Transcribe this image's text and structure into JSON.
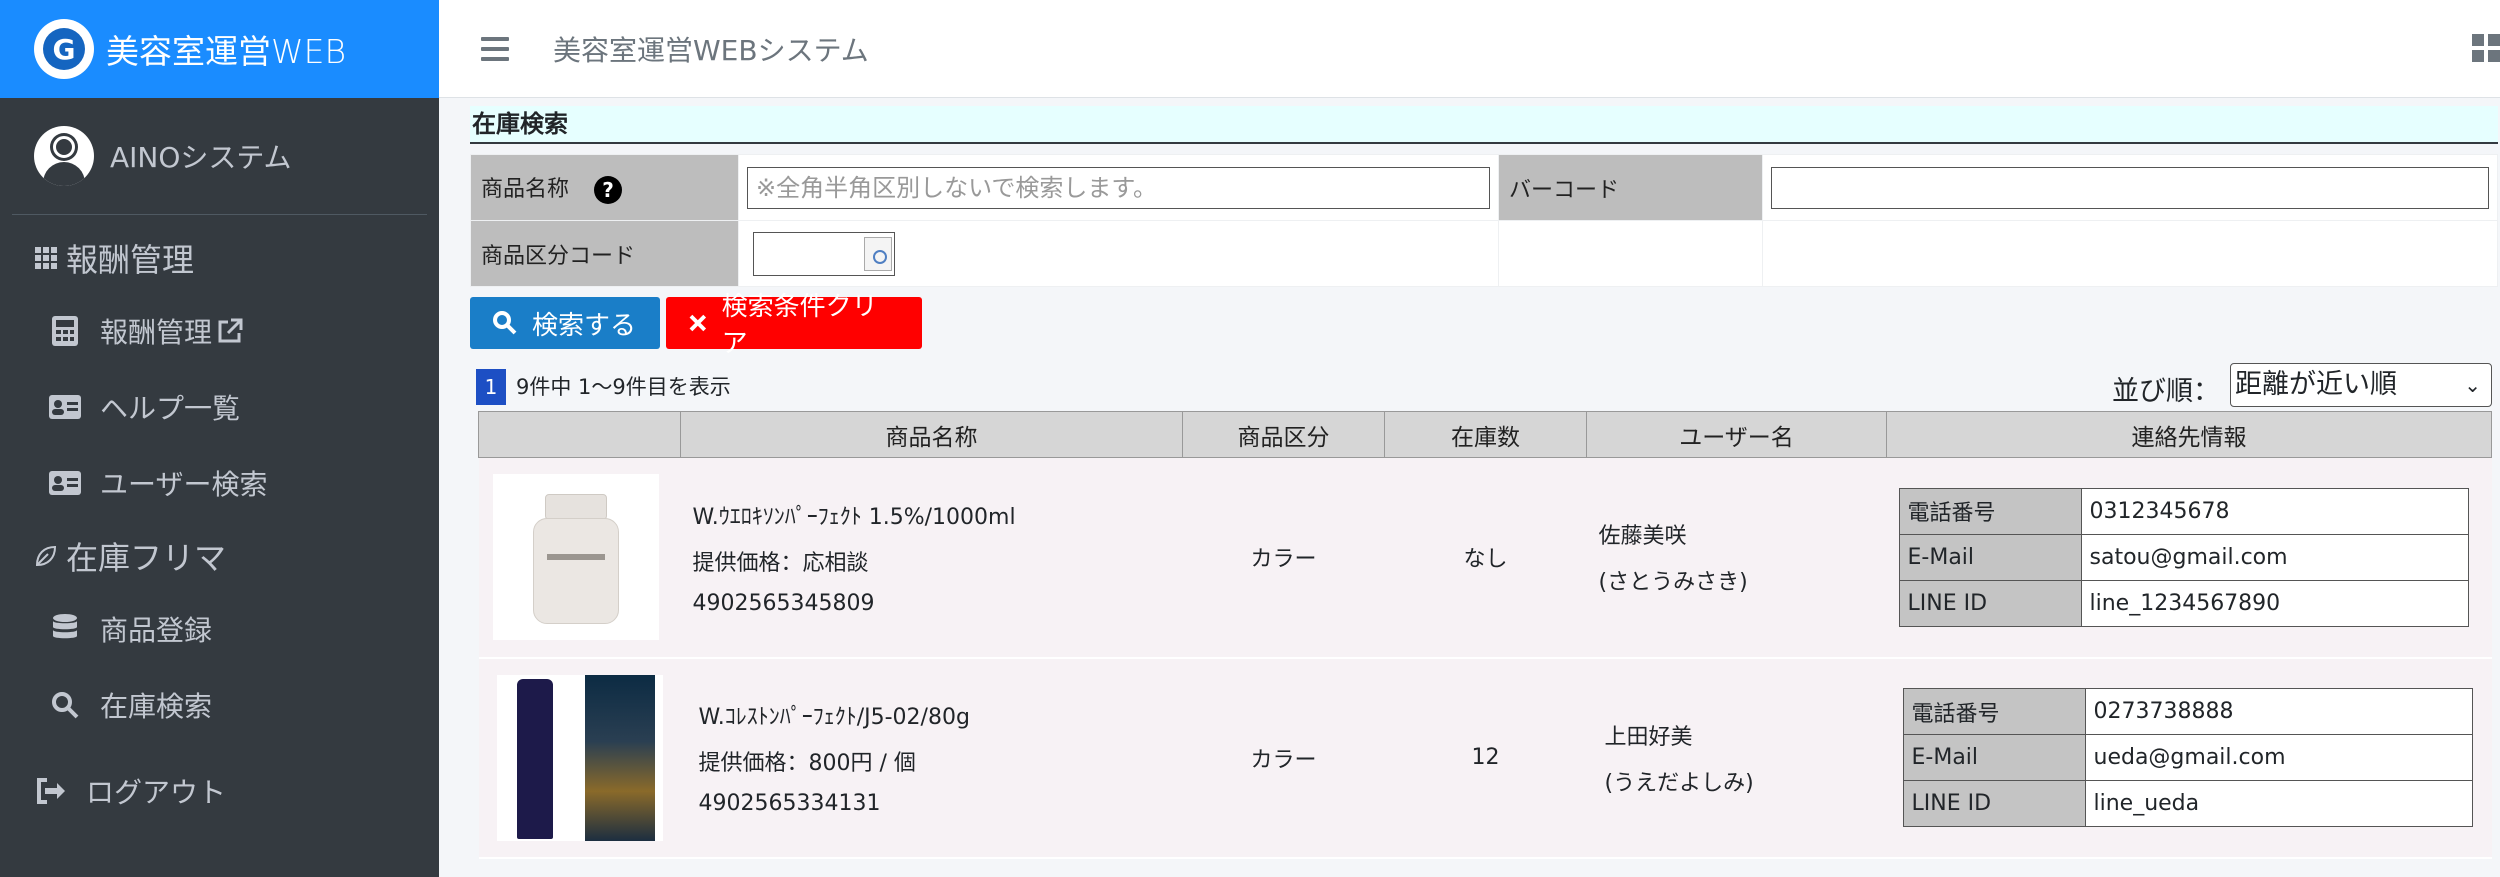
{
  "brand": {
    "logo_letter": "G",
    "name": "美容室運営",
    "suffix": "WEB"
  },
  "user": {
    "name": "AINOシステム"
  },
  "sidebar": {
    "sections": [
      {
        "header": "報酬管理",
        "header_icon": "grid-icon",
        "items": [
          {
            "label": "報酬管理",
            "icon": "calculator-icon",
            "external_icon": "external-link-icon"
          },
          {
            "label": "ヘルプ一覧",
            "icon": "id-card-icon"
          },
          {
            "label": "ユーザー検索",
            "icon": "id-card-icon"
          }
        ]
      },
      {
        "header": "在庫フリマ",
        "header_icon": "leaf-icon",
        "items": [
          {
            "label": "商品登録",
            "icon": "database-icon"
          },
          {
            "label": "在庫検索",
            "icon": "search-icon"
          }
        ]
      }
    ],
    "logout": "ログアウト"
  },
  "topbar": {
    "title": "美容室運営WEBシステム"
  },
  "search": {
    "section_title": "在庫検索",
    "product_name_label": "商品名称",
    "product_name_placeholder": "※全角半角区別しないで検索します。",
    "barcode_label": "バーコード",
    "barcode_value": "",
    "category_label": "商品区分コード",
    "category_value": "",
    "search_button": "検索する",
    "clear_button": "検索条件クリア"
  },
  "results": {
    "page": "1",
    "count_text": "9件中 1～9件目を表示",
    "sort_label": "並び順：",
    "sort_selected": "距離が近い順",
    "headers": [
      "商品名称",
      "商品区分",
      "在庫数",
      "ユーザー名",
      "連絡先情報"
    ],
    "contact_keys": [
      "電話番号",
      "E-Mail",
      "LINE ID"
    ],
    "rows": [
      {
        "name": "W.ｳｴﾛｷｿﾝﾊﾟｰﾌｪｸﾄ 1.5%/1000ml",
        "price": "提供価格：応相談",
        "barcode": "4902565345809",
        "category": "カラー",
        "stock": "なし",
        "user": "佐藤美咲",
        "user_kana": "(さとうみさき)",
        "phone": "0312345678",
        "email": "satou@gmail.com",
        "line": "line_1234567890"
      },
      {
        "name": "W.ｺﾚｽﾄﾝﾊﾟｰﾌｪｸﾄ/J5-02/80g",
        "price": "提供価格：800円 / 個",
        "barcode": "4902565334131",
        "category": "カラー",
        "stock": "12",
        "user": "上田好美",
        "user_kana": "(うえだよしみ)",
        "phone": "0273738888",
        "email": "ueda@gmail.com",
        "line": "line_ueda"
      }
    ]
  },
  "colors": {
    "brand": "#1a8cff",
    "sidebar": "#343a40",
    "search_button": "#1a7ec8",
    "clear_button": "#ff0000",
    "section_bg": "#e6ffff"
  }
}
